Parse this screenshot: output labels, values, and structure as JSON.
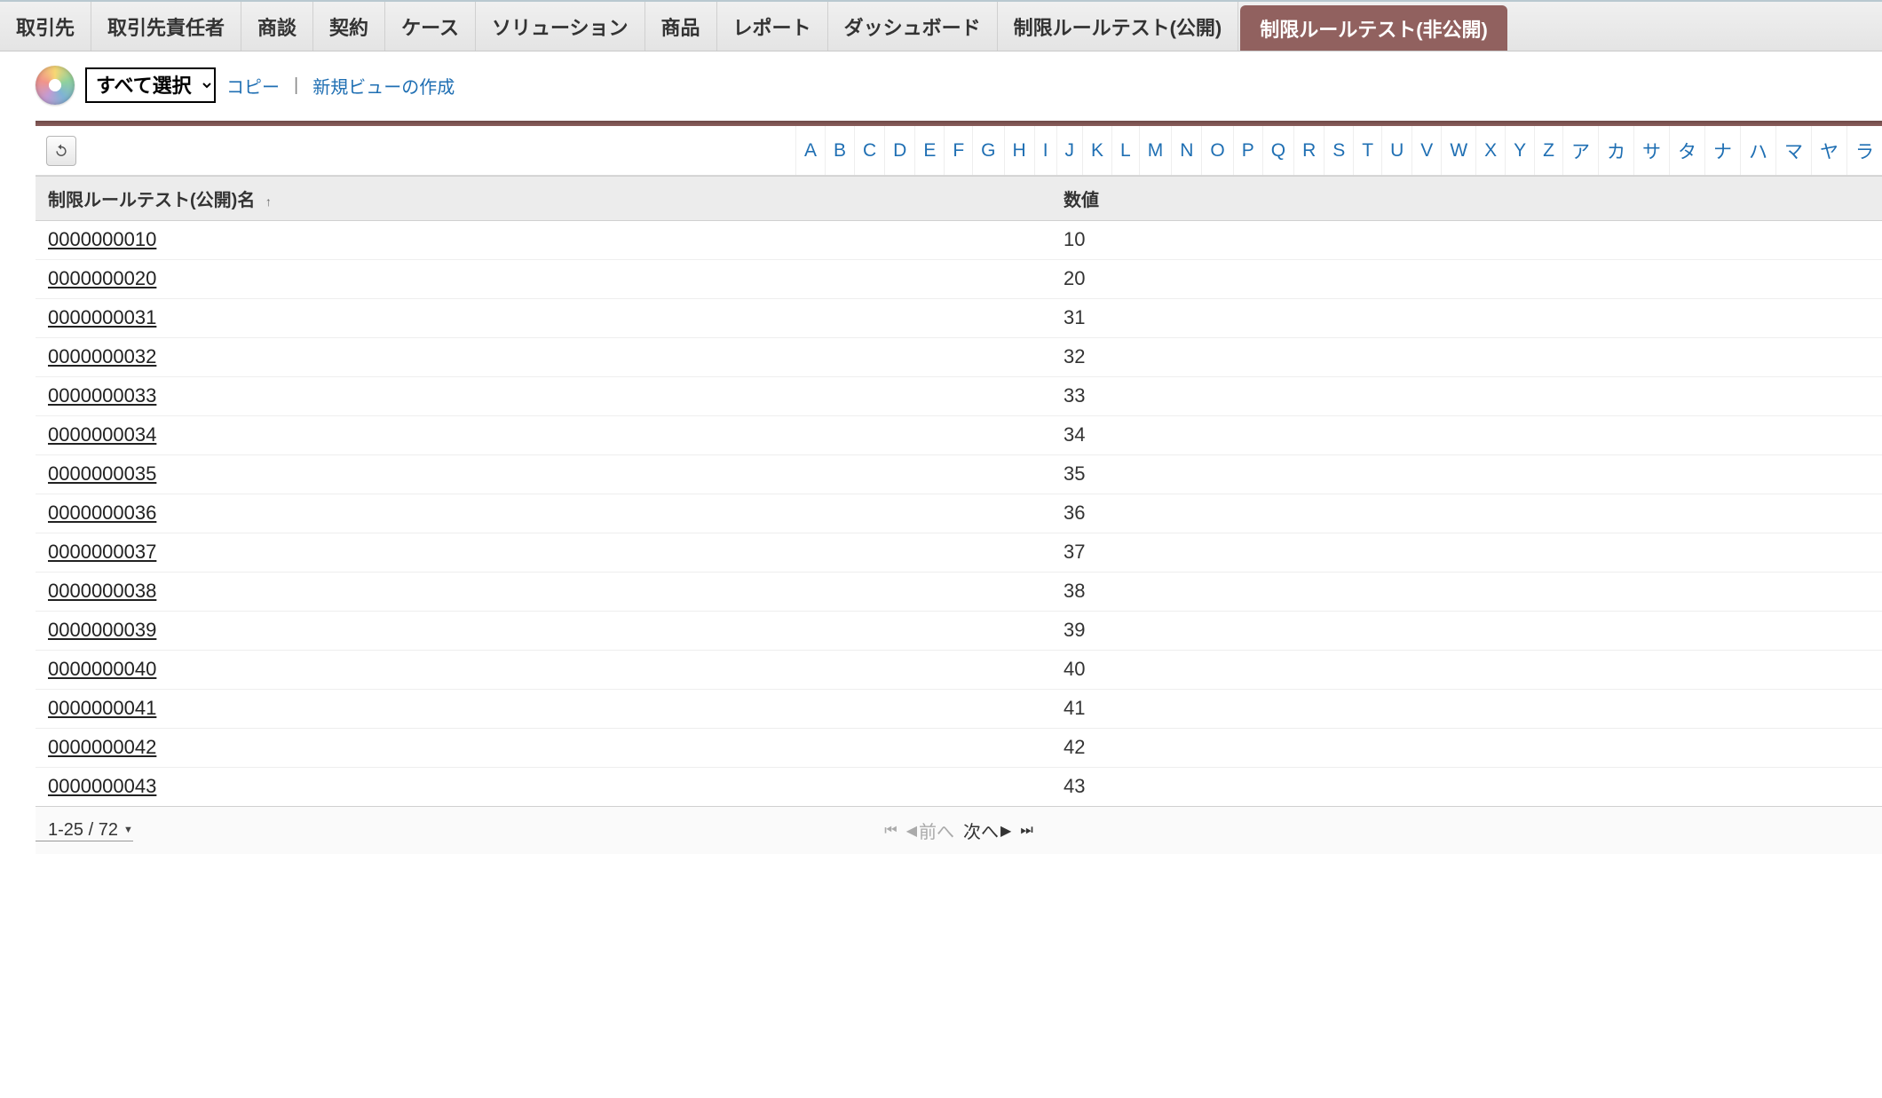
{
  "tabs": [
    {
      "label": "取引先"
    },
    {
      "label": "取引先責任者"
    },
    {
      "label": "商談"
    },
    {
      "label": "契約"
    },
    {
      "label": "ケース"
    },
    {
      "label": "ソリューション"
    },
    {
      "label": "商品"
    },
    {
      "label": "レポート"
    },
    {
      "label": "ダッシュボード"
    },
    {
      "label": "制限ルールテスト(公開)"
    },
    {
      "label": "制限ルールテスト(非公開)",
      "active": true
    }
  ],
  "toolbar": {
    "view_select": "すべて選択",
    "copy_link": "コピー",
    "separator": "|",
    "new_view_link": "新規ビューの作成"
  },
  "alpha": [
    "A",
    "B",
    "C",
    "D",
    "E",
    "F",
    "G",
    "H",
    "I",
    "J",
    "K",
    "L",
    "M",
    "N",
    "O",
    "P",
    "Q",
    "R",
    "S",
    "T",
    "U",
    "V",
    "W",
    "X",
    "Y",
    "Z",
    "ア",
    "カ",
    "サ",
    "タ",
    "ナ",
    "ハ",
    "マ",
    "ヤ",
    "ラ"
  ],
  "columns": {
    "name": "制限ルールテスト(公開)名",
    "value": "数値"
  },
  "rows": [
    {
      "name": "0000000010",
      "value": "10"
    },
    {
      "name": "0000000020",
      "value": "20"
    },
    {
      "name": "0000000031",
      "value": "31"
    },
    {
      "name": "0000000032",
      "value": "32"
    },
    {
      "name": "0000000033",
      "value": "33"
    },
    {
      "name": "0000000034",
      "value": "34"
    },
    {
      "name": "0000000035",
      "value": "35"
    },
    {
      "name": "0000000036",
      "value": "36"
    },
    {
      "name": "0000000037",
      "value": "37"
    },
    {
      "name": "0000000038",
      "value": "38"
    },
    {
      "name": "0000000039",
      "value": "39"
    },
    {
      "name": "0000000040",
      "value": "40"
    },
    {
      "name": "0000000041",
      "value": "41"
    },
    {
      "name": "0000000042",
      "value": "42"
    },
    {
      "name": "0000000043",
      "value": "43"
    }
  ],
  "footer": {
    "range": "1-25 / 72",
    "prev": "前へ",
    "next": "次へ"
  }
}
